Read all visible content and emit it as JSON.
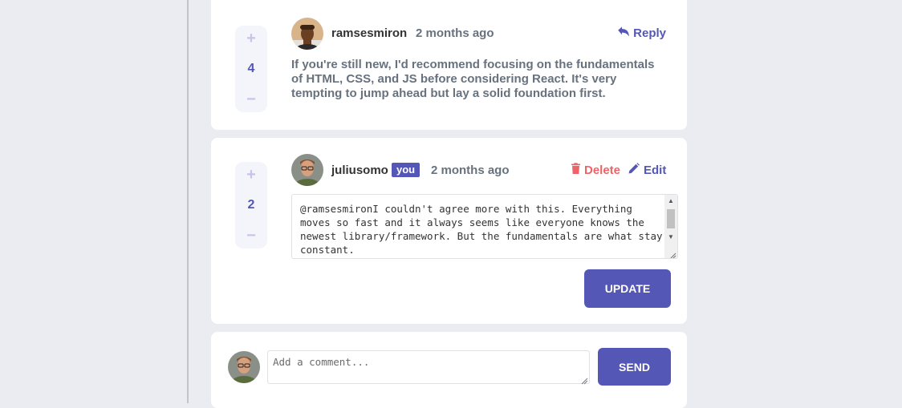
{
  "comments": [
    {
      "username": "ramsesmiron",
      "timestamp": "2 months ago",
      "score": "4",
      "reply_label": "Reply",
      "content": "If you're still new, I'd recommend focusing on the fundamentals of HTML, CSS, and JS before considering React. It's very tempting to jump ahead but lay a solid foundation first."
    },
    {
      "username": "juliusomo",
      "you_badge": "you",
      "timestamp": "2 months ago",
      "score": "2",
      "delete_label": "Delete",
      "edit_label": "Edit",
      "edit_value": "@ramsesmironI couldn't agree more with this. Everything moves so fast and it always seems like everyone knows the newest library/framework. But the fundamentals are what stay constant.",
      "update_label": "UPDATE"
    }
  ],
  "new_comment": {
    "placeholder": "Add a comment...",
    "send_label": "SEND"
  },
  "vote": {
    "plus": "+",
    "minus": "−"
  },
  "icons": {
    "reply": "reply-arrow-icon",
    "delete": "trash-icon",
    "edit": "pencil-icon"
  },
  "colors": {
    "accent": "#5457b6",
    "danger": "#ed6468",
    "vote_light": "#c4c5e8",
    "text_muted": "#67727e",
    "background": "#eaecf1"
  }
}
